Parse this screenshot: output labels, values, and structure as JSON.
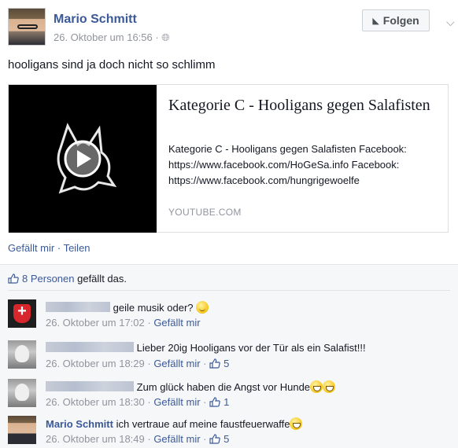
{
  "post": {
    "author": "Mario Schmitt",
    "timestamp": "26. Oktober um 16:56 · ",
    "audience_icon": "globe-icon",
    "follow_label": "Folgen",
    "text": "hooligans sind ja doch nicht so schlimm"
  },
  "link_card": {
    "title": "Kategorie C - Hooligans gegen Salafisten",
    "description": "Kategorie C - Hooligans gegen Salafisten Facebook: https://www.facebook.com/HoGeSa.info Facebook: https://www.facebook.com/hungrigewoelfe",
    "source": "YOUTUBE.COM"
  },
  "actions": {
    "like_label": "Gefällt mir",
    "separator": " · ",
    "share_label": "Teilen"
  },
  "likes": {
    "count_label": "8 Personen",
    "suffix": " gefällt das."
  },
  "comments": [
    {
      "author": "",
      "text": "geile musik oder?",
      "time": "26. Oktober um 17:02",
      "like_label": "Gefällt mir",
      "likes": "",
      "emoji": "smile"
    },
    {
      "author": "",
      "text": "Lieber 20ig Hooligans vor der Tür als ein Salafist!!!",
      "time": "26. Oktober um 18:29",
      "like_label": "Gefällt mir",
      "likes": "5"
    },
    {
      "author": "",
      "text": "Zum glück haben die Angst vor Hunde",
      "time": "26. Oktober um 18:30",
      "like_label": "Gefällt mir",
      "likes": "1",
      "emoji": "laugh"
    },
    {
      "author": "Mario Schmitt",
      "text": "ich vertraue auf meine faustfeuerwaffe",
      "time": "26. Oktober um 18:49",
      "like_label": "Gefällt mir",
      "likes": "5",
      "emoji": "laugh"
    }
  ],
  "colors": {
    "link": "#3b5998",
    "meta": "#90949c",
    "feedback_bg": "#f6f7f9"
  }
}
